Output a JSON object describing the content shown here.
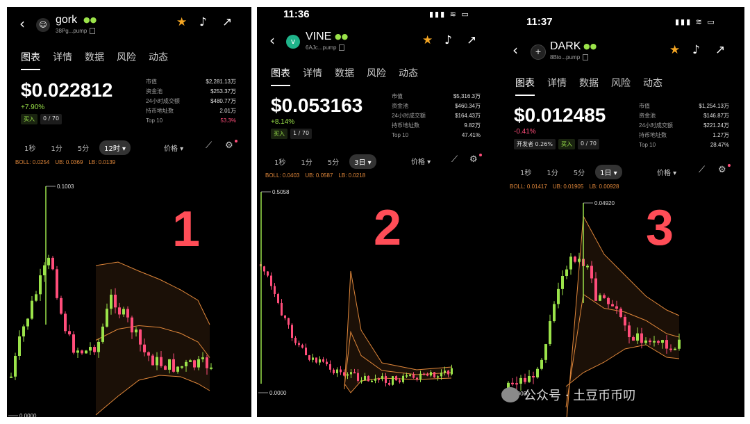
{
  "phones": [
    {
      "token": {
        "name": "gork",
        "address": "38Pg...pump",
        "logo_icon": "robot-icon"
      },
      "tabs": [
        "图表",
        "详情",
        "数据",
        "风险",
        "动态"
      ],
      "price": "$0.022812",
      "change": "+7.90%",
      "badges": [
        "买入",
        "0 / 70"
      ],
      "stats": [
        {
          "label": "市值",
          "value": "$2,281.13万"
        },
        {
          "label": "资金池",
          "value": "$253.37万"
        },
        {
          "label": "24小时成交额",
          "value": "$480.77万"
        },
        {
          "label": "持币地址数",
          "value": "2.01万"
        },
        {
          "label": "Top 10",
          "value": "53.3%"
        }
      ],
      "intervals": [
        "1秒",
        "1分",
        "5分",
        "12时"
      ],
      "selected_interval": "12时",
      "price_menu": "价格",
      "boll": {
        "boll": "BOLL: 0.0254",
        "ub": "UB: 0.0369",
        "lb": "LB: 0.0139"
      },
      "annotation_high": "0.1003",
      "annotation_low": "0.0000",
      "big_number": "1"
    },
    {
      "status_time": "11:36",
      "token": {
        "name": "VINE",
        "address": "6AJc...pump",
        "logo_icon": "vine-logo-icon"
      },
      "tabs": [
        "图表",
        "详情",
        "数据",
        "风险",
        "动态"
      ],
      "price": "$0.053163",
      "change": "+8.14%",
      "badges": [
        "买入",
        "1 / 70"
      ],
      "stats": [
        {
          "label": "市值",
          "value": "$5,316.3万"
        },
        {
          "label": "资金池",
          "value": "$460.34万"
        },
        {
          "label": "24小时成交额",
          "value": "$164.43万"
        },
        {
          "label": "持币地址数",
          "value": "9.82万"
        },
        {
          "label": "Top 10",
          "value": "47.41%"
        }
      ],
      "intervals": [
        "1秒",
        "1分",
        "5分",
        "3日"
      ],
      "selected_interval": "3日",
      "price_menu": "价格",
      "boll": {
        "boll": "BOLL: 0.0403",
        "ub": "UB: 0.0587",
        "lb": "LB: 0.0218"
      },
      "annotation_high": "0.5058",
      "annotation_low": "0.0000",
      "big_number": "2"
    },
    {
      "status_time": "11:37",
      "token": {
        "name": "DARK",
        "address": "8Bto...pump",
        "logo_icon": "dark-logo-icon"
      },
      "tabs": [
        "图表",
        "详情",
        "数据",
        "风险",
        "动态"
      ],
      "price": "$0.012485",
      "change": "-0.41%",
      "badges": [
        "开发者 0.26%",
        "买入",
        "0 / 70"
      ],
      "stats": [
        {
          "label": "市值",
          "value": "$1,254.13万"
        },
        {
          "label": "资金池",
          "value": "$146.87万"
        },
        {
          "label": "24小时成交额",
          "value": "$221.24万"
        },
        {
          "label": "持币地址数",
          "value": "1.27万"
        },
        {
          "label": "Top 10",
          "value": "28.47%"
        }
      ],
      "intervals": [
        "1秒",
        "1分",
        "5分",
        "1日"
      ],
      "selected_interval": "1日",
      "price_menu": "价格",
      "boll": {
        "boll": "BOLL: 0.01417",
        "ub": "UB: 0.01905",
        "lb": "LB: 0.00928"
      },
      "annotation_high": "0.04920",
      "annotation_low": "0.0000",
      "big_number": "3"
    }
  ],
  "watermark": "公众号 · 土豆币币叨",
  "colors": {
    "up": "#9be34a",
    "down": "#ff4d7a",
    "boll": "#e0873a",
    "star": "#f5a623",
    "label": "#ff4d57"
  }
}
